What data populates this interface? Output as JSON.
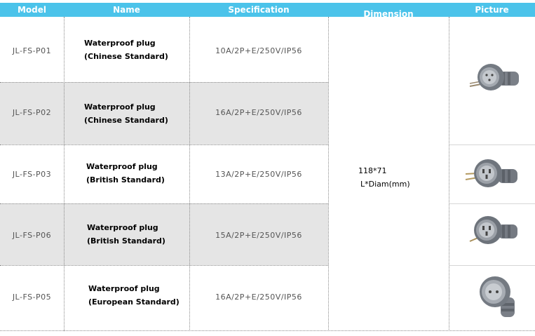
{
  "header": {
    "model": "Model",
    "name": "Name",
    "specification": "Specification",
    "dimension": "Dimension",
    "picture": "Picture"
  },
  "rows": [
    {
      "model": "JL-FS-P01",
      "name_line1": "Waterproof plug",
      "name_line2": "(Chinese Standard)",
      "spec": "10A/2P+E/250V/IP56"
    },
    {
      "model": "JL-FS-P02",
      "name_line1": "Waterproof plug",
      "name_line2": "(Chinese Standard)",
      "spec": "16A/2P+E/250V/IP56"
    },
    {
      "model": "JL-FS-P03",
      "name_line1": "Waterproof plug",
      "name_line2": "(British Standard)",
      "spec": "13A/2P+E/250V/IP56"
    },
    {
      "model": "JL-FS-P06",
      "name_line1": "Waterproof plug",
      "name_line2": "(British Standard)",
      "spec": "15A/2P+E/250V/IP56"
    },
    {
      "model": "JL-FS-P05",
      "name_line1": "Waterproof plug",
      "name_line2": "(European Standard)",
      "spec": "16A/2P+E/250V/IP56"
    }
  ],
  "dimension": {
    "value": "118*71",
    "unit": "L*Diam(mm)"
  },
  "colors": {
    "header_bg": "#4bc3ea",
    "alt_row_bg": "#e5e5e5"
  }
}
